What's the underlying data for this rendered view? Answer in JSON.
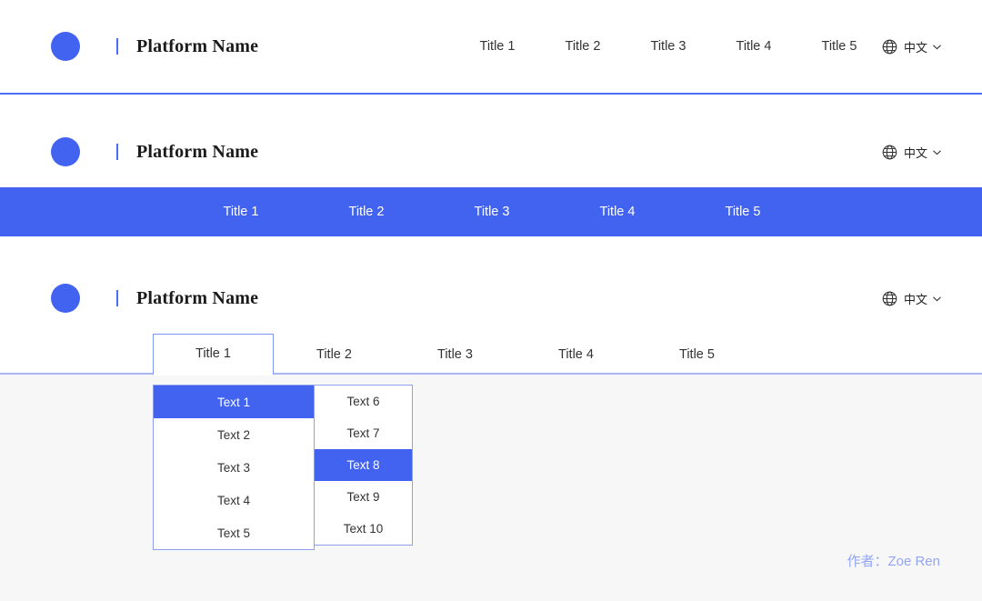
{
  "brand": {
    "name": "Platform Name",
    "logo_color": "#4263f0",
    "separator_color": "#4d6cf5"
  },
  "language": {
    "label": "中文",
    "icon": "globe-icon",
    "chevron": "chevron-down-icon"
  },
  "section1": {
    "nav_items": [
      {
        "label": "Title 1"
      },
      {
        "label": "Title 2"
      },
      {
        "label": "Title 3"
      },
      {
        "label": "Title 4"
      },
      {
        "label": "Title 5"
      }
    ],
    "divider_color": "#4d6cf5"
  },
  "section2": {
    "bar_color": "#4263f0",
    "nav_items": [
      {
        "label": "Title 1"
      },
      {
        "label": "Title 2"
      },
      {
        "label": "Title 3"
      },
      {
        "label": "Title 4"
      },
      {
        "label": "Title 5"
      }
    ]
  },
  "section3": {
    "tabs": [
      {
        "label": "Title 1",
        "active": true
      },
      {
        "label": "Title 2",
        "active": false
      },
      {
        "label": "Title 3",
        "active": false
      },
      {
        "label": "Title 4",
        "active": false
      },
      {
        "label": "Title 5",
        "active": false
      }
    ],
    "underline_color": "#a9b8f5",
    "content_background": "#f7f7f7",
    "menu_primary": [
      {
        "label": "Text 1",
        "selected": true
      },
      {
        "label": "Text 2",
        "selected": false
      },
      {
        "label": "Text 3",
        "selected": false
      },
      {
        "label": "Text 4",
        "selected": false
      },
      {
        "label": "Text 5",
        "selected": false
      }
    ],
    "menu_secondary": [
      {
        "label": "Text 6",
        "selected": false
      },
      {
        "label": "Text 7",
        "selected": false
      },
      {
        "label": "Text 8",
        "selected": true
      },
      {
        "label": "Text 9",
        "selected": false
      },
      {
        "label": "Text 10",
        "selected": false
      }
    ]
  },
  "credit": {
    "text": "作者：Zoe Ren",
    "color": "#93a6f5"
  }
}
